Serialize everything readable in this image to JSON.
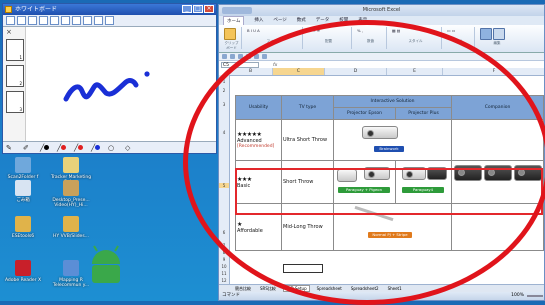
{
  "whiteboard": {
    "title": "ホワイトボード",
    "thumbs": [
      "1",
      "2",
      "3"
    ]
  },
  "desktop_icons": [
    {
      "label": "Scan2Folder f",
      "color": "#6fa8dc"
    },
    {
      "label": "Tracker Marketing Sale...",
      "color": "#e8d27a"
    },
    {
      "label": "ごみ箱",
      "color": "#d8e4f2"
    },
    {
      "label": "Desktop_Prese... Video(HY)_Hi...",
      "color": "#c9a15b"
    },
    {
      "label": "ESEtools6",
      "color": "#e0b34a"
    },
    {
      "label": "HY VVB/Slides...",
      "color": "#e0b34a"
    },
    {
      "label": "Adobe Reader X",
      "color": "#c8202a"
    },
    {
      "label": "Mapping R Telecommun y...",
      "color": "#5b8ed6"
    }
  ],
  "excel": {
    "title": "Microsoft Excel",
    "tabs": [
      "ホーム",
      "挿入",
      "ページ",
      "数式",
      "データ",
      "校閲",
      "表示"
    ],
    "ribbon_groups": [
      "クリップボード",
      "フォント",
      "配置",
      "数値",
      "スタイル",
      "セル",
      "編集"
    ],
    "name_box": "C5",
    "fx": "fx",
    "columns": [
      "B",
      "C",
      "D",
      "E",
      "F"
    ],
    "rows": [
      "1",
      "2",
      "3",
      "4",
      "5",
      "6",
      "7",
      "8",
      "9",
      "10",
      "11",
      "12"
    ],
    "table": {
      "headers": {
        "usability": "Usability",
        "tv_type": "TV type",
        "interactive": "Interactive Solution",
        "projector_epson": "Projector Epson",
        "projector_plus": "Projector Plus",
        "companion": "Companion"
      },
      "rows": [
        {
          "stars": "★★★★★",
          "level": "Advanced",
          "note": "[Recommended]",
          "type": "Ultra Short Throw",
          "btn": "Brainwork"
        },
        {
          "stars": "★★★",
          "level": "Basic",
          "note": "",
          "type": "Short Throw",
          "btn1": "Paraguay + Pigeon",
          "btn2": "Paraguay4"
        },
        {
          "stars": "★",
          "level": "Affordable",
          "note": "",
          "type": "Mid-Long Throw",
          "btn": "Normal PJ + Stripe"
        }
      ]
    },
    "sheet_tabs": [
      "競合比較",
      "SRS比較",
      "LED Setup",
      "Spreadsheet",
      "Spreadsheet2",
      "Sheet1"
    ],
    "status": "コマンド",
    "zoom": "100%"
  },
  "colors": {
    "highlight": "#e0141b",
    "header_blue": "#7da3d6"
  }
}
